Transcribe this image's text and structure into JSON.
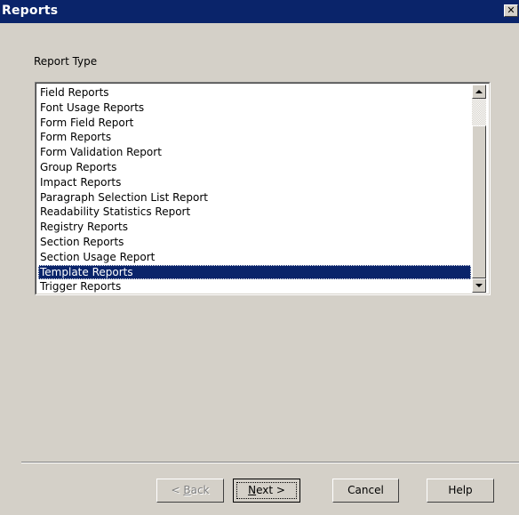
{
  "window": {
    "title": "Reports",
    "close_glyph": "✕",
    "close_icon": "close-icon"
  },
  "report_type": {
    "label": "Report Type",
    "items": [
      "Field Reports",
      "Font Usage Reports",
      "Form Field Report",
      "Form Reports",
      "Form Validation Report",
      "Group Reports",
      "Impact Reports",
      "Paragraph Selection List Report",
      "Readability Statistics Report",
      "Registry Reports",
      "Section Reports",
      "Section Usage Report",
      "Template Reports",
      "Trigger Reports"
    ],
    "selected": "Template Reports"
  },
  "buttons": {
    "back_prefix": "< ",
    "back_mnemonic": "B",
    "back_rest": "ack",
    "next_mnemonic": "N",
    "next_rest": "ext >",
    "cancel": "Cancel",
    "help": "Help"
  },
  "colors": {
    "selection_bg": "#0a246a",
    "titlebar_bg": "#0a246a",
    "dialog_bg": "#d4d0c8"
  }
}
